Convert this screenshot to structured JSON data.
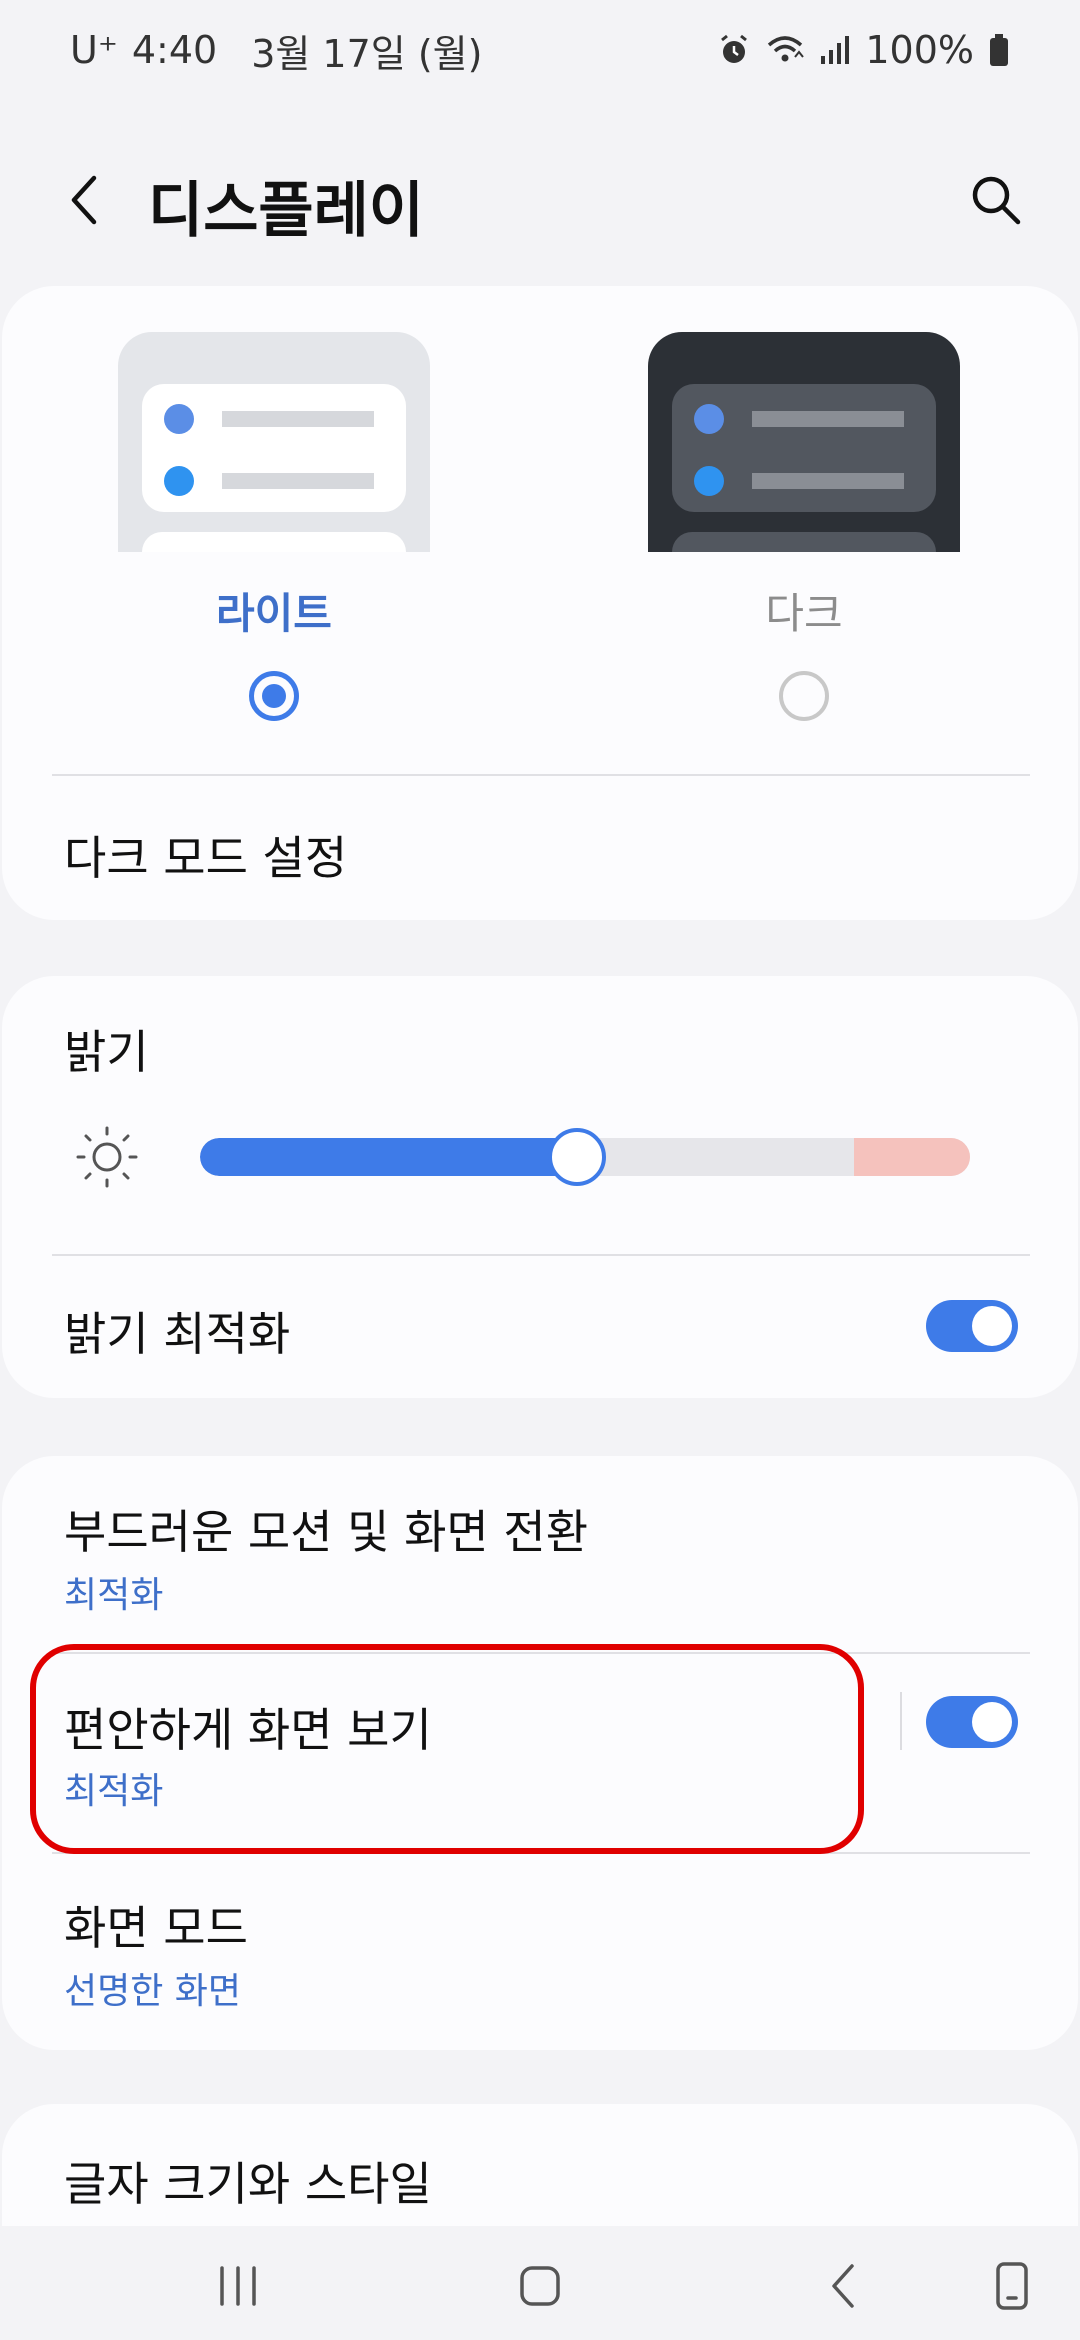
{
  "status": {
    "carrier": "U⁺",
    "time": "4:40",
    "date": "3월 17일 (월)",
    "battery": "100%",
    "icons": [
      "alarm-icon",
      "wifi-icon",
      "signal-icon",
      "battery-icon"
    ]
  },
  "header": {
    "title": "디스플레이",
    "back_icon": "chevron-left-icon",
    "search_icon": "search-icon"
  },
  "theme": {
    "light_label": "라이트",
    "dark_label": "다크",
    "selected": "light"
  },
  "dark_mode_settings": "다크 모드 설정",
  "brightness": {
    "title": "밝기",
    "level": 0.49,
    "adaptive_label": "밝기 최적화",
    "adaptive_on": true
  },
  "motion": {
    "title": "부드러운 모션 및 화면 전환",
    "value": "최적화"
  },
  "eye_comfort": {
    "title": "편안하게 화면 보기",
    "value": "최적화",
    "on": true
  },
  "screen_mode": {
    "title": "화면 모드",
    "value": "선명한 화면"
  },
  "font": {
    "title": "글자 크기와 스타일"
  },
  "navbar": [
    "recent-apps-icon",
    "home-icon",
    "back-icon",
    "keyboard-switch-icon"
  ],
  "colors": {
    "accent": "#3e7be8",
    "accent_text": "#3e6fc9",
    "highlight": "#e00000",
    "background": "#f3f3f6"
  }
}
